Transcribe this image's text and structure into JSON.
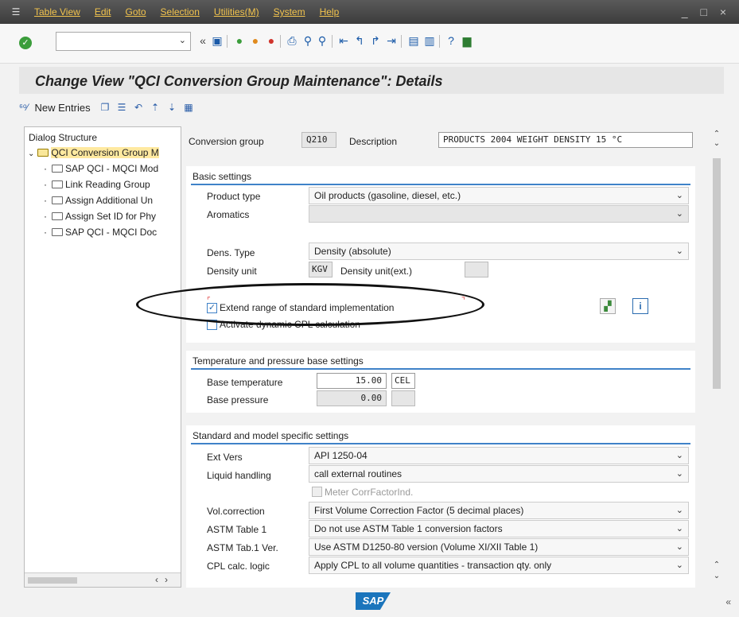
{
  "menu": {
    "items": [
      "Table View",
      "Edit",
      "Goto",
      "Selection",
      "Utilities(M)",
      "System",
      "Help"
    ],
    "window_controls": "_ □ ×"
  },
  "toolbar": {
    "command_field_value": "",
    "icons": [
      "enter-icon",
      "back-icon",
      "save-icon",
      "back-green-icon",
      "exit-icon",
      "cancel-icon",
      "print-icon",
      "find-icon",
      "find-next-icon",
      "first-page-icon",
      "previous-page-icon",
      "next-page-icon",
      "last-page-icon",
      "create-session-icon",
      "shortcut-icon",
      "help-icon",
      "customize-layout-icon"
    ]
  },
  "page": {
    "title": "Change View \"QCI Conversion Group Maintenance\": Details"
  },
  "app_toolbar": {
    "new_entries": "New Entries"
  },
  "dialog_structure": {
    "heading": "Dialog Structure",
    "root": "QCI Conversion Group M",
    "children": [
      "SAP QCI - MQCI Mod",
      "Link Reading Group",
      "Assign Additional Un",
      "Assign Set ID for Phy",
      "SAP QCI - MQCI Doc"
    ]
  },
  "header_fields": {
    "conversion_group_label": "Conversion group",
    "conversion_group_value": "Q210",
    "description_label": "Description",
    "description_value": "PRODUCTS 2004 WEIGHT DENSITY 15 °C"
  },
  "basic_settings": {
    "title": "Basic settings",
    "product_type_label": "Product type",
    "product_type_value": "Oil products (gasoline, diesel, etc.)",
    "aromatics_label": "Aromatics",
    "aromatics_value": "",
    "dens_type_label": "Dens. Type",
    "dens_type_value": "Density (absolute)",
    "density_unit_label": "Density unit",
    "density_unit_value": "KGV",
    "density_unit_ext_label": "Density unit(ext.)",
    "density_unit_ext_value": "",
    "extend_range_label": "Extend range of standard implementation",
    "extend_range_checked": true,
    "activate_dynamic_label": "Activate dynamic CPL calculation",
    "activate_dynamic_checked": false
  },
  "temp_pressure": {
    "title": "Temperature and pressure base settings",
    "base_temp_label": "Base temperature",
    "base_temp_value": "15.00",
    "base_temp_unit": "CEL",
    "base_pressure_label": "Base pressure",
    "base_pressure_value": "0.00",
    "base_pressure_unit": ""
  },
  "standard_model": {
    "title": "Standard and model specific settings",
    "ext_vers_label": "Ext Vers",
    "ext_vers_value": "API 1250-04",
    "liquid_handling_label": "Liquid handling",
    "liquid_handling_value": "call external routines",
    "meter_corr_label": "Meter CorrFactorInd.",
    "vol_correction_label": "Vol.correction",
    "vol_correction_value": "First Volume Correction Factor (5 decimal places)",
    "astm_table1_label": "ASTM Table 1",
    "astm_table1_value": "Do not use ASTM Table 1 conversion factors",
    "astm_tab1_ver_label": "ASTM Tab.1 Ver.",
    "astm_tab1_ver_value": "Use ASTM D1250-80 version (Volume XI/XII Table 1)",
    "cpl_calc_label": "CPL calc. logic",
    "cpl_calc_value": "Apply CPL to all volume quantities - transaction qty. only"
  },
  "footer": {
    "logo": "SAP",
    "collapse": "«"
  },
  "colors": {
    "menubar": "#3c3c3c",
    "menu_text": "#f3c44d",
    "group_line": "#3f82c8",
    "sap_blue": "#1b75bc"
  }
}
